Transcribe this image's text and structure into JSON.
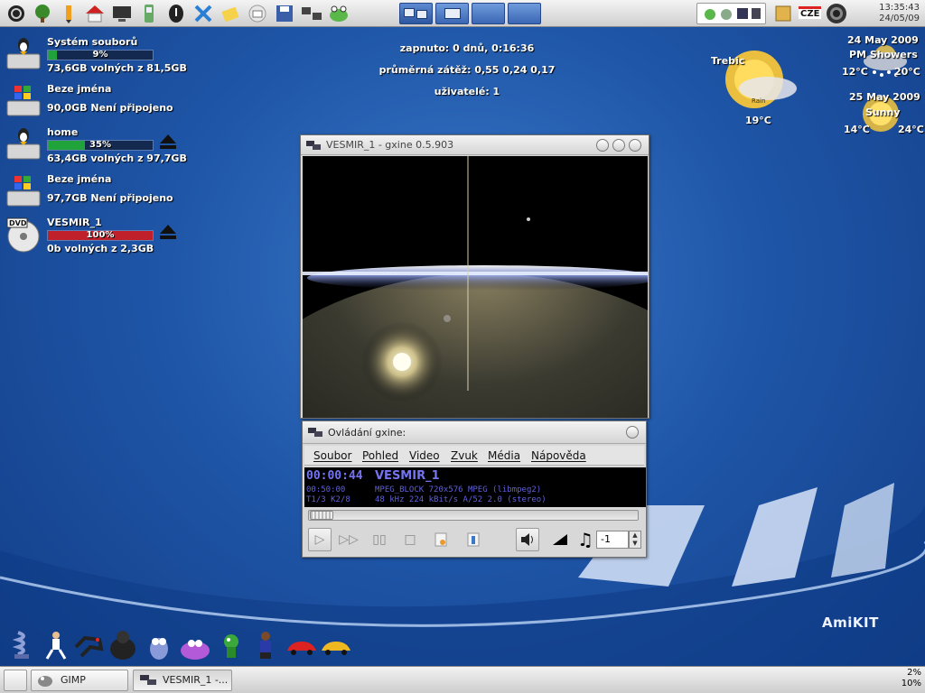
{
  "desktop": {
    "drives": [
      {
        "name": "Systém souborů",
        "percent": "9%",
        "fill": 0.09,
        "fill_color": "#1fa33a",
        "info": "73,6GB volných z 81,5GB",
        "icon": "linux-drive-icon",
        "eject": false
      },
      {
        "name": "Beze jména",
        "percent": "",
        "info": "90,0GB Není připojeno",
        "icon": "windows-drive-icon",
        "eject": false
      },
      {
        "name": "home",
        "percent": "35%",
        "fill": 0.35,
        "fill_color": "#1fa33a",
        "info": "63,4GB volných z 97,7GB",
        "icon": "linux-drive-icon",
        "eject": true
      },
      {
        "name": "Beze jména",
        "percent": "",
        "info": "97,7GB Není připojeno",
        "icon": "windows-drive-icon",
        "eject": false
      },
      {
        "name": "VESMIR_1",
        "percent": "100%",
        "fill": 1.0,
        "fill_color": "#c0202a",
        "info": "0b volných z 2,3GB",
        "icon": "dvd-icon",
        "eject": true
      }
    ],
    "sysinfo": {
      "uptime": "zapnuto: 0 dnů, 0:16:36",
      "load": "průměrná zátěž: 0,55 0,24 0,17",
      "users": "uživatelé: 1"
    },
    "weather": {
      "city": "Trebic",
      "current_temp": "19°C",
      "current_icon_label": "Rain",
      "day1_date": "24 May 2009",
      "day1_desc": "PM Showers",
      "day1_low": "12°C",
      "day1_high": "20°C",
      "day2_date": "25 May 2009",
      "day2_desc": "Sunny",
      "day2_low": "14°C",
      "day2_high": "24°C"
    },
    "brand": "AmiKIT"
  },
  "topbar": {
    "keyboard_layout": "CZE",
    "clock_time": "13:35:43",
    "clock_date": "24/05/09",
    "launcher_icons": [
      "amiga-icon",
      "tree-icon",
      "pencil-icon",
      "home-icon",
      "monitor-icon",
      "phone-icon",
      "info-icon",
      "x-tools-icon",
      "notepad-icon",
      "mail-icon",
      "save-icon",
      "network-icon",
      "frog-icon"
    ],
    "workspaces": [
      "1",
      "2",
      "3",
      "4"
    ]
  },
  "player": {
    "video_title": "VESMIR_1 - gxine 0.5.903",
    "control_title": "Ovládání gxine:",
    "menu": [
      "Soubor",
      "Pohled",
      "Video",
      "Zvuk",
      "Média",
      "Nápověda"
    ],
    "time_current": "00:00:44",
    "media_title": "VESMIR_1",
    "time_total": "00:50:00",
    "track_info": "T1/3 K2/8",
    "video_info": "MPEG_BLOCK 720x576 MPEG (libmpeg2)",
    "audio_info": "48 kHz 224 kBit/s A/52 2.0 (stereo)",
    "seek_position": 0.015,
    "spin_value": "-1"
  },
  "taskbar": {
    "tasks": [
      {
        "label": "",
        "icon": "desktop-icon"
      },
      {
        "label": "GIMP",
        "icon": "gimp-icon"
      },
      {
        "label": "VESMIR_1 -...",
        "icon": "gxine-icon"
      }
    ],
    "cpu_top": "2%",
    "cpu_bottom": "10%"
  }
}
